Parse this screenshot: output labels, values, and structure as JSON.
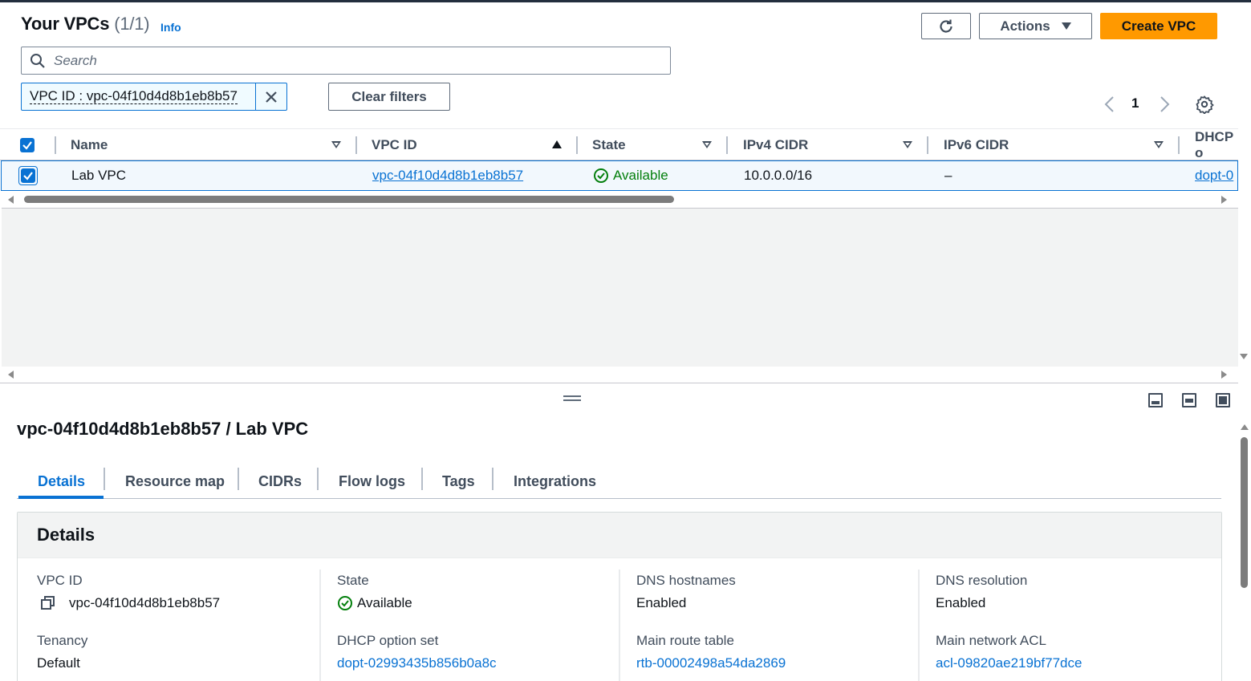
{
  "header": {
    "title": "Your VPCs",
    "count": "(1/1)",
    "info": "Info",
    "actions_label": "Actions",
    "create_label": "Create VPC"
  },
  "search": {
    "placeholder": "Search"
  },
  "filter": {
    "token": "VPC ID : vpc-04f10d4d8b1eb8b57",
    "clear_label": "Clear filters"
  },
  "pagination": {
    "page": "1"
  },
  "table": {
    "columns": [
      "Name",
      "VPC ID",
      "State",
      "IPv4 CIDR",
      "IPv6 CIDR",
      "DHCP o"
    ],
    "rows": [
      {
        "name": "Lab VPC",
        "vpc_id": "vpc-04f10d4d8b1eb8b57",
        "state": "Available",
        "ipv4": "10.0.0.0/16",
        "ipv6": "–",
        "dhcp": "dopt-0"
      }
    ]
  },
  "panel": {
    "title": "vpc-04f10d4d8b1eb8b57 / Lab VPC",
    "tabs": [
      "Details",
      "Resource map",
      "CIDRs",
      "Flow logs",
      "Tags",
      "Integrations"
    ],
    "active_tab": "Details",
    "card_title": "Details",
    "fields": {
      "vpc_id_label": "VPC ID",
      "vpc_id": "vpc-04f10d4d8b1eb8b57",
      "state_label": "State",
      "state": "Available",
      "dns_hostnames_label": "DNS hostnames",
      "dns_hostnames": "Enabled",
      "dns_resolution_label": "DNS resolution",
      "dns_resolution": "Enabled",
      "tenancy_label": "Tenancy",
      "tenancy": "Default",
      "dhcp_label": "DHCP option set",
      "dhcp": "dopt-02993435b856b0a8c",
      "route_table_label": "Main route table",
      "route_table": "rtb-00002498a54da2869",
      "acl_label": "Main network ACL",
      "acl": "acl-09820ae219bf77dce"
    }
  },
  "colors": {
    "accent": "#0972d3",
    "primary_button": "#ff9900",
    "success": "#037f0c"
  },
  "icons": [
    "refresh-icon",
    "caret-down-icon",
    "search-icon",
    "close-icon",
    "chevron-left-icon",
    "chevron-right-icon",
    "settings-icon",
    "checkbox-icon",
    "sort-icon",
    "status-ok-icon",
    "copy-icon",
    "drag-handle-icon",
    "panel-position-icon"
  ]
}
